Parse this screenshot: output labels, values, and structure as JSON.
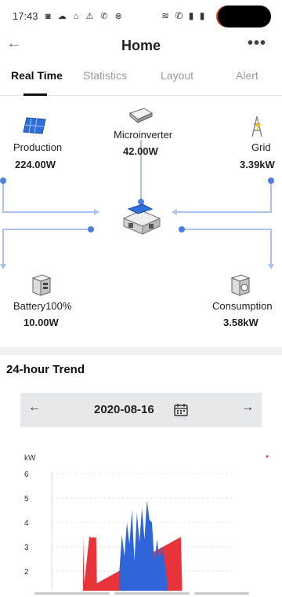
{
  "status_bar": {
    "time": "17:43"
  },
  "header": {
    "title": "Home",
    "back_icon": "back-arrow-icon",
    "more_icon": "more-dots-icon"
  },
  "tabs": [
    {
      "label": "Real Time",
      "active": true
    },
    {
      "label": "Statistics",
      "active": false
    },
    {
      "label": "Layout",
      "active": false
    },
    {
      "label": "Alert",
      "active": false
    }
  ],
  "flow": {
    "production": {
      "label": "Production",
      "value": "224.00W",
      "icon": "solar-panel-icon"
    },
    "microinverter": {
      "label": "Microinverter",
      "value": "42.00W",
      "icon": "microinverter-icon"
    },
    "grid": {
      "label": "Grid",
      "value": "3.39kW",
      "icon": "grid-tower-icon"
    },
    "battery": {
      "label": "Battery100%",
      "value": "10.00W",
      "icon": "battery-icon"
    },
    "consumption": {
      "label": "Consumption",
      "value": "3.58kW",
      "icon": "appliances-icon"
    },
    "house_icon": "house-icon",
    "line_color": "#a9c3ee",
    "dot_color": "#4a7fe0"
  },
  "trend": {
    "title": "24-hour Trend",
    "date": "2020-08-16",
    "prev_icon": "prev-arrow-icon",
    "next_icon": "next-arrow-icon",
    "calendar_icon": "calendar-icon"
  },
  "chart_data": {
    "type": "area",
    "ylabel": "kW",
    "yticks": [
      "6",
      "5",
      "4",
      "3",
      "2"
    ],
    "ylim": [
      1.5,
      6
    ],
    "grid": true,
    "series": [
      {
        "color": "#e8333b",
        "x": [
          6.5,
          6.6,
          7.0,
          7.1,
          7.2,
          7.35,
          7.45,
          7.55,
          7.6,
          14.3,
          14.4
        ],
        "values": [
          3.4,
          1.5,
          3.4,
          3.4,
          3.35,
          3.4,
          3.35,
          3.4,
          1.5,
          3.4,
          1.5
        ]
      },
      {
        "color": "#2f65d8",
        "x": [
          9.4,
          9.6,
          9.8,
          10.0,
          10.2,
          10.4,
          10.6,
          10.8,
          11.0,
          11.2,
          11.4,
          11.6,
          11.8,
          12.0,
          12.2,
          12.4,
          12.6,
          12.8,
          13.0,
          13.2
        ],
        "values": [
          2.0,
          3.5,
          2.6,
          4.0,
          3.1,
          4.5,
          2.4,
          4.4,
          3.2,
          4.6,
          3.3,
          4.9,
          4.1,
          4.0,
          2.3,
          3.3,
          2.5,
          3.0,
          2.4,
          1.6
        ]
      }
    ]
  }
}
